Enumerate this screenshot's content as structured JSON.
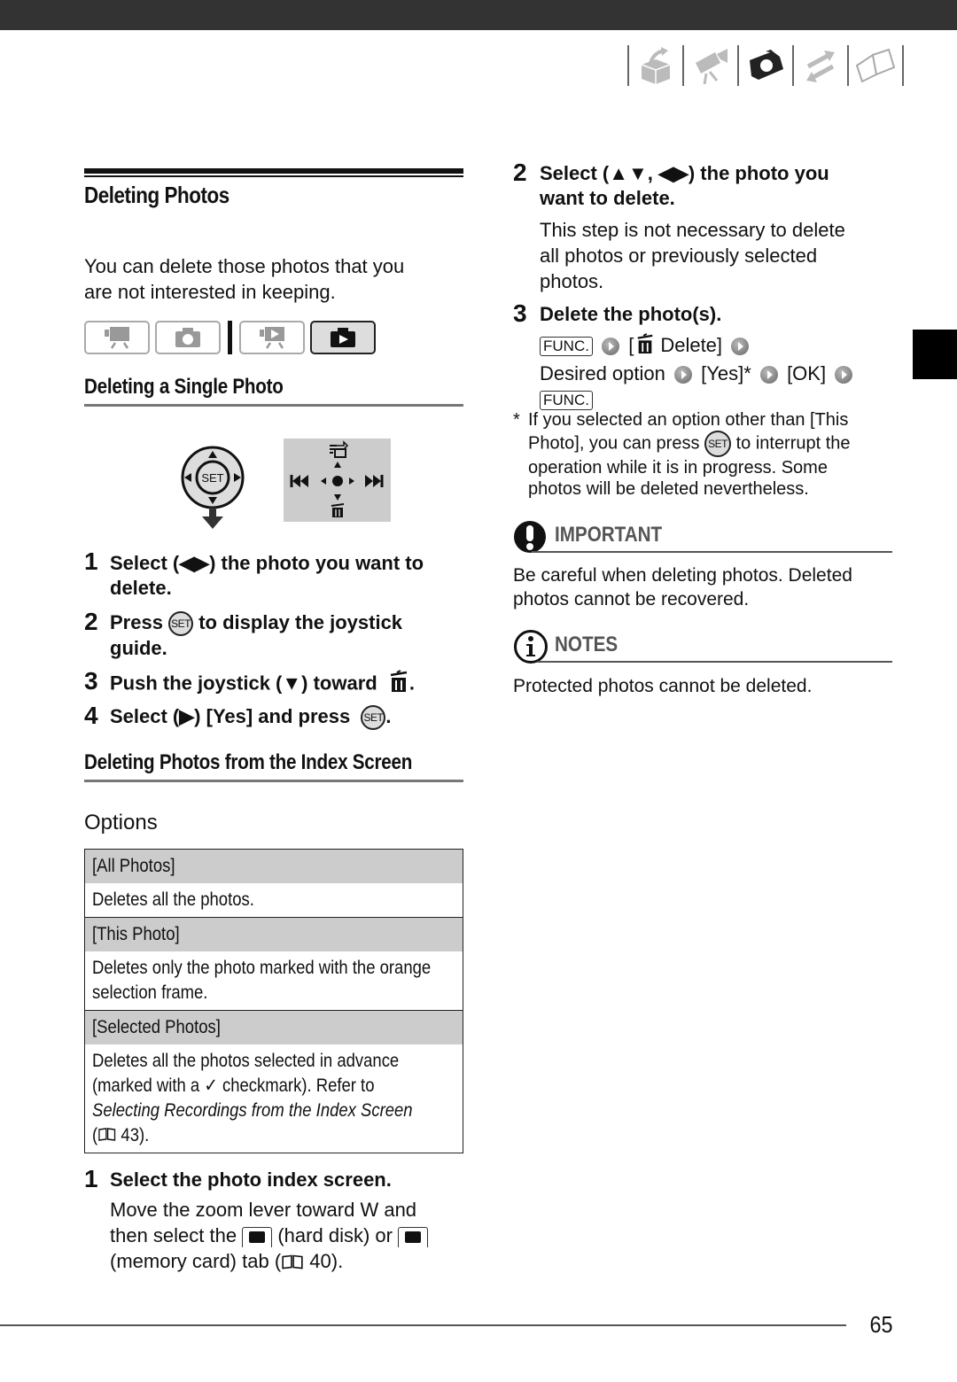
{
  "header": {
    "nav_icons": [
      "box-arrow-icon",
      "movie-camera-icon",
      "camera-icon",
      "transfer-arrows-icon",
      "book-icon"
    ],
    "active_icon": "camera-icon"
  },
  "left": {
    "section_title": "Deleting Photos",
    "intro": [
      "You can delete those photos that you",
      "are not interested in keeping."
    ],
    "mode_icons": [
      "movie-record-mode",
      "photo-record-mode",
      "movie-play-mode",
      "photo-play-mode"
    ],
    "single_title": "Deleting a Single Photo",
    "joystick_label": "SET",
    "single_steps": [
      {
        "num": "1",
        "text_a": "Select (◀▶) the photo you want to",
        "text_b": "delete."
      },
      {
        "num": "2",
        "text_a_pre": "Press",
        "text_a_post": "to display the joystick",
        "text_b": "guide."
      },
      {
        "num": "3",
        "text_a": "Push the joystick (▼) toward",
        "text_suffix": "."
      },
      {
        "num": "4",
        "text_a": "Select (▶) [Yes] and press",
        "text_suffix": "."
      }
    ],
    "index_title": "Deleting Photos from the Index Screen",
    "options_label": "Options",
    "options": [
      {
        "name": "[All Photos]",
        "desc": [
          "Deletes all the photos."
        ]
      },
      {
        "name": "[This Photo]",
        "desc": [
          "Deletes only the photo marked with the orange",
          "selection frame."
        ]
      },
      {
        "name": "[Selected Photos]",
        "desc_1": "Deletes all the photos selected in advance",
        "desc_2_pre": "(marked with a",
        "desc_2_post": "checkmark). Refer to",
        "desc_3_italic": "Selecting Recordings from the Index Screen",
        "desc_4": "43)."
      }
    ],
    "index_step1": {
      "num": "1",
      "title": "Select the photo index screen.",
      "line1": "Move the zoom lever toward W and",
      "line2_pre": "then select the",
      "line2_mid": "(hard disk) or",
      "line3_pre": "(memory card) tab (",
      "line3_post": "40)."
    }
  },
  "right": {
    "step2": {
      "num": "2",
      "title_a": "Select (▲▼, ◀▶) the photo you",
      "title_b": "want to delete.",
      "desc": [
        "This step is not necessary to delete",
        "all photos or previously selected",
        "photos."
      ]
    },
    "step3": {
      "num": "3",
      "title": "Delete the photo(s).",
      "func_label": "FUNC.",
      "open_bracket": "[",
      "delete_label": "Delete]",
      "desired_option": "Desired option",
      "yes": "[Yes]*",
      "ok": "[OK]"
    },
    "footnote": {
      "mark": "*",
      "line1": "If you selected an option other than [This",
      "line2_pre": "Photo], you can press",
      "line2_post": "to interrupt the",
      "line3": "operation while it is in progress. Some",
      "line4": "photos will be deleted nevertheless."
    },
    "important": {
      "heading": "IMPORTANT",
      "text": [
        "Be careful when deleting photos. Deleted",
        "photos cannot be recovered."
      ]
    },
    "notes": {
      "heading": "NOTES",
      "text": "Protected photos cannot be deleted."
    }
  },
  "footer": {
    "page_number": "65"
  }
}
